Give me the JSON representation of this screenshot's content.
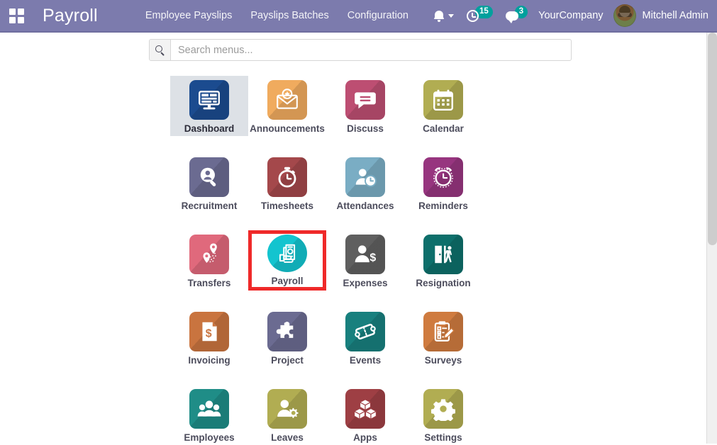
{
  "navbar": {
    "apps_icon": "grid-apps-icon",
    "brand": "Payroll",
    "menu_items": [
      {
        "label": "Employee Payslips"
      },
      {
        "label": "Payslips Batches"
      },
      {
        "label": "Configuration"
      }
    ],
    "notification_icon": "bell-icon",
    "activity_icon": "clock-icon",
    "activity_count": "15",
    "messaging_icon": "chat-icon",
    "messaging_count": "3",
    "company": "YourCompany",
    "avatar_icon": "user-avatar",
    "user": "Mitchell Admin",
    "accent_color": "#7c7bad",
    "badge_color": "#00a09d"
  },
  "search": {
    "icon": "search-icon",
    "placeholder": "Search menus...",
    "value": ""
  },
  "apps": [
    {
      "label": "Dashboard",
      "icon": "monitor-dashboard-icon",
      "color": "#1b4b8f",
      "state": "selected",
      "shape": "square"
    },
    {
      "label": "Announcements",
      "icon": "envelope-star-icon",
      "color": "#f0ab5e",
      "state": "normal",
      "shape": "square"
    },
    {
      "label": "Discuss",
      "icon": "speech-bubble-icon",
      "color": "#bd4e72",
      "state": "normal",
      "shape": "square"
    },
    {
      "label": "Calendar",
      "icon": "calendar-icon",
      "color": "#b1ad52",
      "state": "normal",
      "shape": "square"
    },
    {
      "label": "Recruitment",
      "icon": "magnifier-person-icon",
      "color": "#6b6b91",
      "state": "normal",
      "shape": "square"
    },
    {
      "label": "Timesheets",
      "icon": "stopwatch-icon",
      "color": "#a4484b",
      "state": "normal",
      "shape": "square"
    },
    {
      "label": "Attendances",
      "icon": "person-clock-icon",
      "color": "#7aadc4",
      "state": "normal",
      "shape": "square"
    },
    {
      "label": "Reminders",
      "icon": "alarm-clock-icon",
      "color": "#97357f",
      "state": "normal",
      "shape": "square"
    },
    {
      "label": "Transfers",
      "icon": "map-pins-route-icon",
      "color": "#e0697c",
      "state": "normal",
      "shape": "square"
    },
    {
      "label": "Payroll",
      "icon": "money-payslip-icon",
      "color": "#13c4cf",
      "state": "highlighted",
      "shape": "round"
    },
    {
      "label": "Expenses",
      "icon": "person-dollar-icon",
      "color": "#5f5f5f",
      "state": "normal",
      "shape": "square"
    },
    {
      "label": "Resignation",
      "icon": "door-exit-icon",
      "color": "#0d6f6b",
      "state": "normal",
      "shape": "square"
    },
    {
      "label": "Invoicing",
      "icon": "invoice-dollar-icon",
      "color": "#c9743f",
      "state": "normal",
      "shape": "square"
    },
    {
      "label": "Project",
      "icon": "puzzle-piece-icon",
      "color": "#6b6b91",
      "state": "normal",
      "shape": "square"
    },
    {
      "label": "Events",
      "icon": "ticket-icon",
      "color": "#18807e",
      "state": "normal",
      "shape": "square"
    },
    {
      "label": "Surveys",
      "icon": "clipboard-pencil-icon",
      "color": "#cf7b3f",
      "state": "normal",
      "shape": "square"
    },
    {
      "label": "Employees",
      "icon": "people-group-icon",
      "color": "#1f8d87",
      "state": "normal",
      "shape": "square"
    },
    {
      "label": "Leaves",
      "icon": "person-gear-icon",
      "color": "#b1ad52",
      "state": "normal",
      "shape": "square"
    },
    {
      "label": "Apps",
      "icon": "boxes-icon",
      "color": "#9e3f44",
      "state": "normal",
      "shape": "square"
    },
    {
      "label": "Settings",
      "icon": "gear-icon",
      "color": "#b1ad52",
      "state": "normal",
      "shape": "square"
    }
  ],
  "highlight": {
    "color": "#ef2929",
    "target": "Payroll"
  }
}
